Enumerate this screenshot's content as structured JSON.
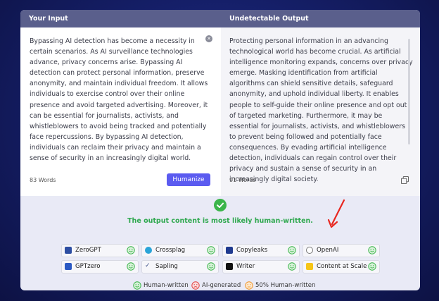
{
  "header": {
    "left_title": "Your Input",
    "right_title": "Undetectable Output"
  },
  "input": {
    "text": "Bypassing AI detection has become a necessity in certain scenarios. As AI surveillance technologies advance, privacy concerns arise. Bypassing AI detection can protect personal information, preserve anonymity, and maintain individual freedom. It allows individuals to exercise control over their online presence and avoid targeted advertising. Moreover, it can be essential for journalists, activists, and whistleblowers to avoid being tracked and potentially face repercussions. By bypassing AI detection, individuals can reclaim their privacy and maintain a sense of security in an increasingly digital world.",
    "word_count": "83 Words",
    "button": "Humanize"
  },
  "output": {
    "text": "Protecting personal information in an advancing technological world has become crucial. As artificial intelligence monitoring expands, concerns over privacy emerge. Masking identification from artificial algorithms can shield sensitive details, safeguard anonymity, and uphold individual liberty. It enables people to self-guide their online presence and opt out of targeted marketing. Furthermore, it may be essential for journalists, activists, and whistleblowers to prevent being followed and potentially face consequences. By evading artificial intelligence detection, individuals can regain control over their privacy and sustain a sense of security in an increasingly digital society.",
    "word_count": "91 Words"
  },
  "result": {
    "message": "The output content is most likely human-written.",
    "detectors": [
      {
        "name": "ZeroGPT",
        "icon": "zerogpt-icon",
        "status": "human-written"
      },
      {
        "name": "Crossplag",
        "icon": "crossplag-icon",
        "status": "human-written"
      },
      {
        "name": "Copyleaks",
        "icon": "copyleaks-icon",
        "status": "human-written"
      },
      {
        "name": "OpenAI",
        "icon": "openai-icon",
        "status": "human-written"
      },
      {
        "name": "GPTzero",
        "icon": "gptzero-icon",
        "status": "human-written"
      },
      {
        "name": "Sapling",
        "icon": "sapling-icon",
        "status": "human-written"
      },
      {
        "name": "Writer",
        "icon": "writer-icon",
        "status": "human-written"
      },
      {
        "name": "Content at Scale",
        "icon": "content-at-scale-icon",
        "status": "human-written"
      }
    ],
    "legend": {
      "human": "Human-written",
      "ai": "AI-generated",
      "half": "50% Human-written"
    }
  },
  "colors": {
    "accent": "#5b5bf0",
    "success": "#3bb54a",
    "annotation_arrow": "#e8261f"
  }
}
